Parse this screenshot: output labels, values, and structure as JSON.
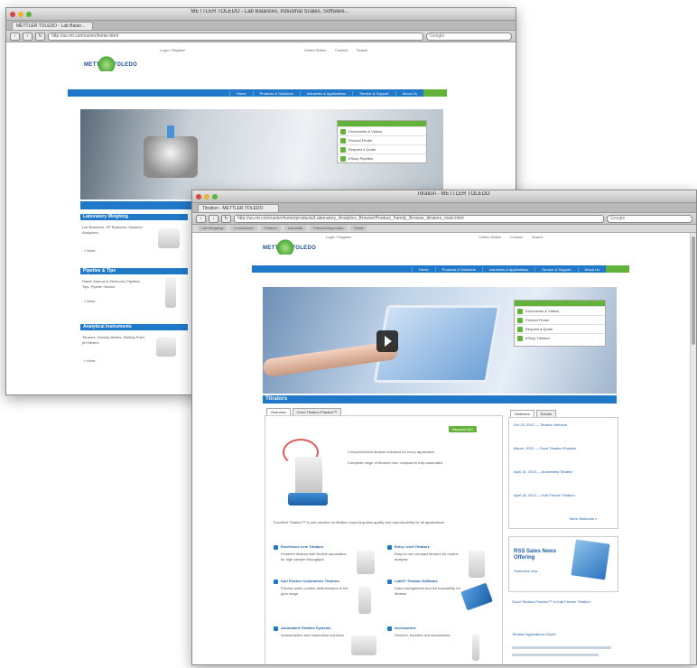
{
  "window_back": {
    "title": "METTLER TOLEDO - Lab Balances, Industrial Scales, Software...",
    "tab": "METTLER TOLEDO - Lab Balan...",
    "url": "http://us.mt.com/us/en/home.html",
    "search_placeholder": "Google",
    "logo": "METTLER TOLEDO",
    "top_links": [
      "Login / Register",
      "United States",
      "Contact",
      "Search"
    ],
    "nav_items": [
      "Home",
      "Products & Solutions",
      "Industries & Applications",
      "Service & Support",
      "About Us"
    ],
    "panel_items": [
      "Documents & Videos",
      "Product Finder",
      "Request a Quote",
      "eShop Pipettes"
    ],
    "sections": [
      {
        "title": "Laboratory Weighing",
        "text": "Lab Balances, XP Balances, Moisture Analyzers",
        "more": "» More"
      },
      {
        "title": "Pipettes & Tips",
        "text": "Rainin Manual & Electronic Pipettes, Tips, Pipette Service",
        "more": "» More"
      },
      {
        "title": "Analytical Instruments",
        "text": "Titrators, Density Meters, Melting Point, pH Meters",
        "more": "» More"
      }
    ]
  },
  "window_front": {
    "title": "Titration - METTLER TOLEDO",
    "tab": "Titration - METTLER TOLEDO",
    "url": "http://us.mt.com/us/en/home/products/Laboratory_Analytics_Browse/Product_Family_Browse_titrators_main.html",
    "search_placeholder": "Google",
    "bookmarks": [
      "Lab Weighing",
      "Customized",
      "Titration",
      "Industrial",
      "Product Inspection",
      "Retail"
    ],
    "logo": "METTLER TOLEDO",
    "top_links": [
      "Login / Register",
      "United States",
      "Contact",
      "Search"
    ],
    "nav_items": [
      "Home",
      "Products & Solutions",
      "Industries & Applications",
      "Service & Support",
      "About Us"
    ],
    "panel_items": [
      "Documents & Videos",
      "Product Finder",
      "Request a Quote",
      "eShop Titration"
    ],
    "page_title": "Titrators",
    "subtabs": [
      "Overview",
      "Good Titration Practice™"
    ],
    "request_btn": "Request Info",
    "intro_text": "Comprehensive titration solutions for every application",
    "intro_text2": "Complete range of titrators from compact to fully automated",
    "body_text": "Excellent Titration™ is one practice for titration improving data quality and reproducibility for all applications",
    "products": [
      {
        "name": "Excellence Line Titrators",
        "desc": "Powerful titrators with flexible automation for high sample throughput"
      },
      {
        "name": "Entry Level Titrators",
        "desc": "Easy to use compact titrators for routine analysis"
      },
      {
        "name": "Karl Fischer Coulometric Titrators",
        "desc": "Precise water content determination in the ppm range"
      },
      {
        "name": "LabX® Titration Software",
        "desc": "Data management and full traceability for titration"
      },
      {
        "name": "Automated Titration Systems",
        "desc": "Autosamplers and automation solutions"
      },
      {
        "name": "Accessories",
        "desc": "Sensors, burettes and accessories"
      }
    ],
    "sidebar_tabs": [
      "Webinars",
      "Events"
    ],
    "sidebar_items": [
      "Oct 23, 2012 — Titration Webinar",
      "March, 2013 — Good Titration Practice",
      "April 16, 2013 — Automated Titration",
      "April 18, 2013 — Karl Fischer Titration"
    ],
    "sidebar_more": "More Webinars »",
    "promo_title": "RSS Sales News Offering",
    "promo_text": "Subscribe now",
    "sidebar_extra": "Good Titration Practice™ in Karl Fischer Titration",
    "sidebar_extra2": "Titration Applications Guide"
  }
}
